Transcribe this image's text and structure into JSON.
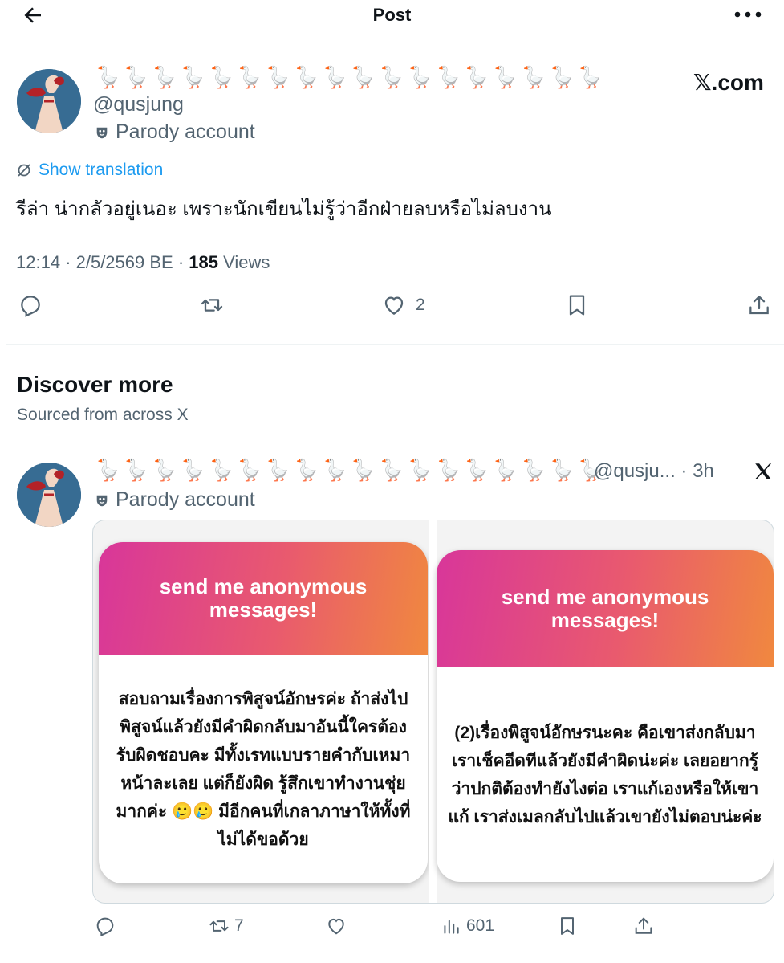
{
  "header": {
    "title": "Post"
  },
  "post": {
    "display_name": "🪿🪿🪿🪿🪿🪿🪿🪿🪿🪿🪿🪿🪿🪿🪿🪿🪿🪿",
    "handle": "@qusjung",
    "parody_label": "Parody account",
    "watermark": "𝕏.com",
    "translate_label": "Show translation",
    "text": "รีล่า น่ากลัวอยู่เนอะ เพราะนักเขียนไม่รู้ว่าอีกฝ่ายลบหรือไม่ลบงาน",
    "time": "12:14 · 2/5/2569 BE · ",
    "views_count": "185",
    "views_label": " Views",
    "likes": "2"
  },
  "discover": {
    "title": "Discover more",
    "subtitle": "Sourced from across X"
  },
  "post2": {
    "display_name": "🪿🪿🪿🪿🪿🪿🪿🪿🪿🪿🪿🪿🪿🪿🪿🪿🪿🪿",
    "handle_time": "@qusju... · 3h",
    "parody_label": "Parody account",
    "cards": [
      {
        "header": "send me anonymous messages!",
        "body": "สอบถามเรื่องการพิสูจน์อักษรค่ะ ถ้าส่งไปพิสูจน์แล้วยังมีคำผิดกลับมาอันนี้ใครต้องรับผิดชอบคะ มีทั้งเรทแบบรายคำกับเหมาหน้าละเลย แต่ก็ยังผิด รู้สึกเขาทำงานชุ่ยมากค่ะ 🥲🥲 มีอีกคนที่เกลาภาษาให้ทั้งที่ไม่ได้ขอด้วย"
      },
      {
        "header": "send me anonymous messages!",
        "body": "(2)เรื่องพิสูจน์อักษรนะคะ คือเขาส่งกลับมาเราเช็คอีดทีแล้วยังมีคำผิดน่ะค่ะ เลยอยากรู้ว่าปกติต้องทำยังไงต่อ เราแก้เองหรือให้เขาแก้ เราส่งเมลกลับไปแล้วเขายังไม่ตอบน่ะค่ะ"
      }
    ],
    "retweets": "7",
    "views": "601"
  }
}
